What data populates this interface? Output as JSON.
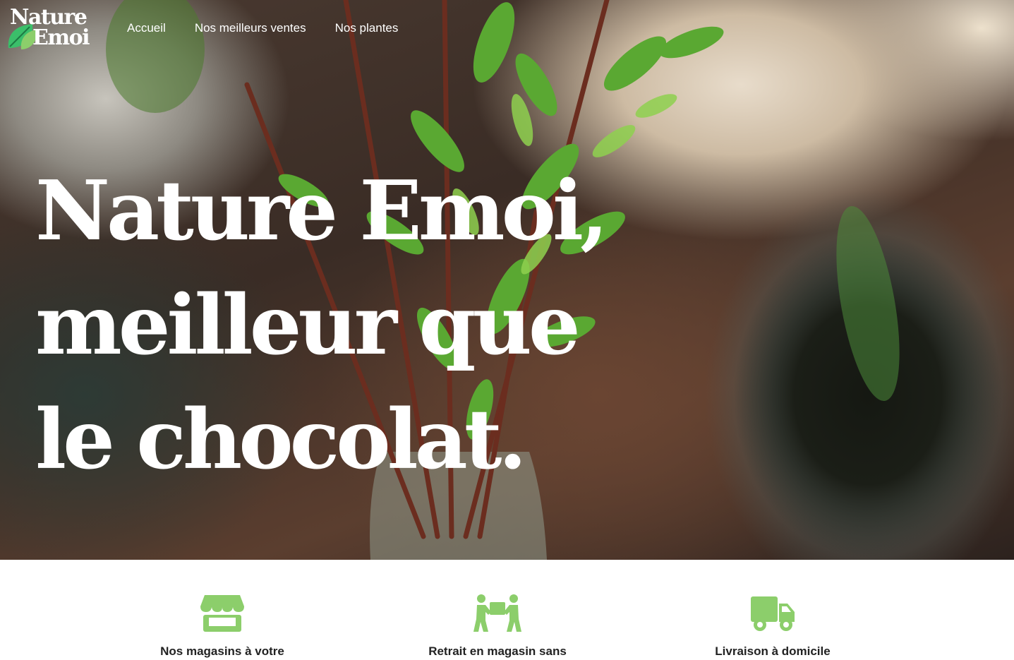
{
  "brand": {
    "logo_line1": "Nature",
    "logo_line2": "Emoi"
  },
  "nav": {
    "items": [
      "Accueil",
      "Nos meilleurs ventes",
      "Nos plantes"
    ]
  },
  "hero": {
    "title_line1": "Nature Emoi,",
    "title_line2": "meilleur que",
    "title_line3": "le chocolat."
  },
  "features": [
    {
      "label": "Nos magasins à votre",
      "icon": "store-icon"
    },
    {
      "label": "Retrait en magasin sans",
      "icon": "people-carry-box-icon"
    },
    {
      "label": "Livraison à domicile",
      "icon": "delivery-truck-icon"
    }
  ],
  "colors": {
    "accent_green": "#8cce6b",
    "text_dark": "#222222",
    "hero_text": "#ffffff"
  }
}
